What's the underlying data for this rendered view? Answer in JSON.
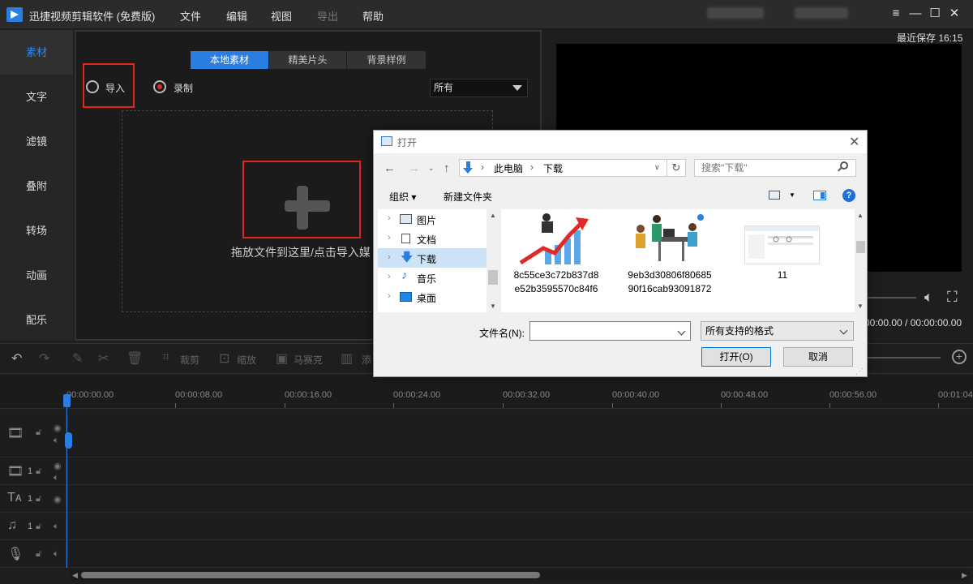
{
  "app": {
    "title": "迅捷视频剪辑软件 (免费版)",
    "menu": [
      {
        "label": "文件",
        "enabled": true
      },
      {
        "label": "编辑",
        "enabled": true
      },
      {
        "label": "视图",
        "enabled": true
      },
      {
        "label": "导出",
        "enabled": false
      },
      {
        "label": "帮助",
        "enabled": true
      }
    ],
    "window_buttons": [
      "≡",
      "—",
      "☐",
      "✕"
    ]
  },
  "leftnav": {
    "items": [
      {
        "label": "素材",
        "active": true
      },
      {
        "label": "文字"
      },
      {
        "label": "滤镜"
      },
      {
        "label": "叠附"
      },
      {
        "label": "转场"
      },
      {
        "label": "动画"
      },
      {
        "label": "配乐"
      }
    ]
  },
  "media": {
    "tabs": [
      "本地素材",
      "精美片头",
      "背景样例"
    ],
    "active_tab": "本地素材",
    "import_label": "导入",
    "record_label": "录制",
    "filter_value": "所有",
    "drop_hint": "拖放文件到这里/点击导入媒"
  },
  "preview": {
    "save_status": "最近保存 16:15",
    "time_readout": "00:00.00 / 00:00:00.00"
  },
  "toolbar": {
    "crop": "裁剪",
    "zoom": "缩放",
    "mosaic": "马赛克",
    "add": "添"
  },
  "timeline": {
    "ticks": [
      "00:00:00.00",
      "00:00:08.00",
      "00:00:16.00",
      "00:00:24.00",
      "00:00:32.00",
      "00:00:40.00",
      "00:00:48.00",
      "00:00:56.00",
      "00:01:04"
    ],
    "tracks": [
      {
        "icon": "film-icon",
        "number": ""
      },
      {
        "icon": "video-track-icon",
        "number": "1"
      },
      {
        "icon": "text-track-icon",
        "number": "1"
      },
      {
        "icon": "music-track-icon",
        "number": "1"
      },
      {
        "icon": "mic-track-icon",
        "number": ""
      }
    ]
  },
  "dialog": {
    "title": "打开",
    "path": [
      "此电脑",
      "下载"
    ],
    "search_placeholder": "搜索\"下载\"",
    "organize": "组织 ▾",
    "new_folder": "新建文件夹",
    "tree": [
      {
        "label": "图片",
        "selected": false
      },
      {
        "label": "文档",
        "selected": false
      },
      {
        "label": "下载",
        "selected": true
      },
      {
        "label": "音乐",
        "selected": false
      },
      {
        "label": "桌面",
        "selected": false
      }
    ],
    "files": [
      {
        "name": "8c55ce3c72b837d8e52b3595570c84f6"
      },
      {
        "name": "9eb3d30806f8068590f16cab93091872"
      },
      {
        "name": "11"
      }
    ],
    "filename_label": "文件名(N):",
    "filename_value": "",
    "filetype": "所有支持的格式",
    "open_button": "打开(O)",
    "cancel_button": "取消"
  }
}
